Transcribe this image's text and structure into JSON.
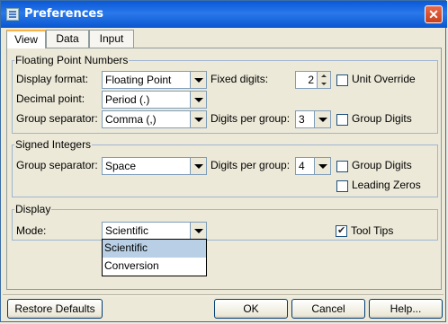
{
  "window": {
    "title": "Preferences",
    "close_glyph": "✕"
  },
  "tabs": [
    {
      "label": "View"
    },
    {
      "label": "Data"
    },
    {
      "label": "Input"
    }
  ],
  "floating": {
    "legend": "Floating Point Numbers",
    "display_format_label": "Display format:",
    "display_format_value": "Floating Point",
    "fixed_digits_label": "Fixed digits:",
    "fixed_digits_value": "2",
    "unit_override_label": "Unit Override",
    "decimal_point_label": "Decimal point:",
    "decimal_point_value": "Period (.)",
    "group_sep_label": "Group separator:",
    "group_sep_value": "Comma (,)",
    "digits_per_group_label": "Digits per group:",
    "digits_per_group_value": "3",
    "group_digits_label": "Group Digits"
  },
  "signed": {
    "legend": "Signed Integers",
    "group_sep_label": "Group separator:",
    "group_sep_value": "Space",
    "digits_per_group_label": "Digits per group:",
    "digits_per_group_value": "4",
    "group_digits_label": "Group Digits",
    "leading_zeros_label": "Leading Zeros"
  },
  "display": {
    "legend": "Display",
    "mode_label": "Mode:",
    "mode_value": "Scientific",
    "mode_options": [
      "Scientific",
      "Conversion"
    ],
    "tool_tips_label": "Tool Tips",
    "tool_tips_checked": true
  },
  "buttons": {
    "restore": "Restore Defaults",
    "ok": "OK",
    "cancel": "Cancel",
    "help": "Help..."
  }
}
